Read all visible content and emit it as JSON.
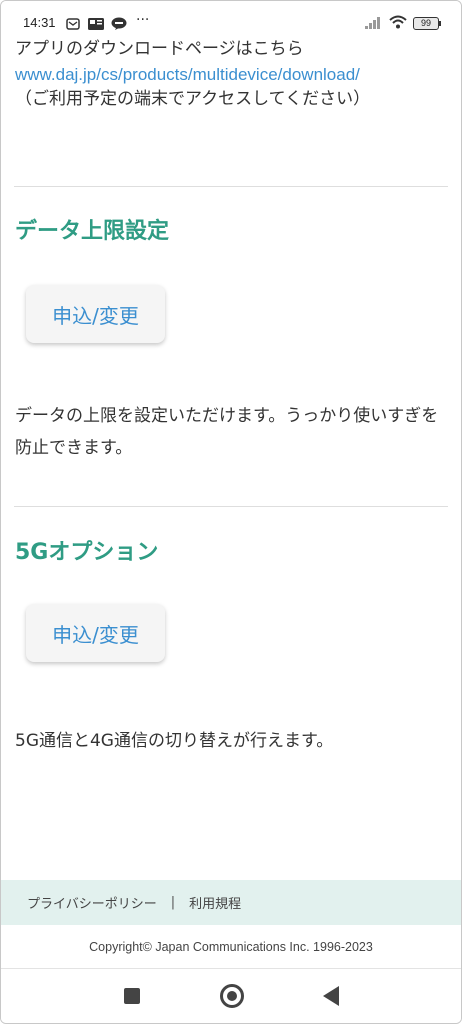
{
  "status_bar": {
    "time": "14:31",
    "battery": "99",
    "more": "···"
  },
  "intro": {
    "line1": "アプリのダウンロードページはこちら",
    "link": "www.daj.jp/cs/products/multidevice/download/",
    "line3": "（ご利用予定の端末でアクセスしてください）"
  },
  "sections": [
    {
      "title": "データ上限設定",
      "button": "申込/変更",
      "description": "データの上限を設定いただけます。うっかり使いすぎを防止できます。"
    },
    {
      "title": "5Gオプション",
      "button": "申込/変更",
      "description": "5G通信と4G通信の切り替えが行えます。"
    }
  ],
  "footer": {
    "privacy": "プライバシーポリシー",
    "separator": "|",
    "terms": "利用規程",
    "copyright": "Copyright© Japan Communications Inc. 1996-2023"
  },
  "colors": {
    "accent_green": "#2f9c84",
    "link_blue": "#3b8fd0",
    "footer_bg": "#e2f1ee"
  }
}
